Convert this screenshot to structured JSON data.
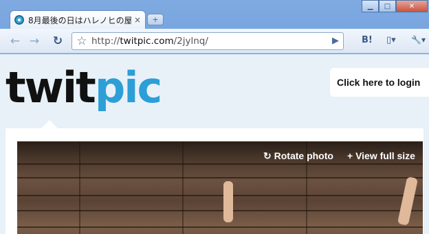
{
  "window": {
    "minimize_glyph": "▁",
    "maximize_glyph": "□",
    "close_glyph": "✕"
  },
  "tab": {
    "title": "8月最後の日はハレノヒの屋...",
    "close_glyph": "×",
    "newtab_glyph": "+"
  },
  "toolbar": {
    "back_glyph": "←",
    "forward_glyph": "→",
    "reload_glyph": "↻",
    "star_glyph": "☆",
    "url_prefix": "http://",
    "url_host": "twitpic.com",
    "url_path": "/2jylnq/",
    "go_glyph": "▶",
    "hatena_label": "B!",
    "page_glyph": "▯▾",
    "wrench_glyph": "🔧▾"
  },
  "site": {
    "logo_part1": "twit",
    "logo_part2": "pic",
    "login_label": "Click here to login",
    "rotate_label": "↻ Rotate photo",
    "fullsize_label": "+ View full size"
  },
  "colors": {
    "logo_blue": "#2d9fd6",
    "page_bg": "#e8f1f8"
  }
}
